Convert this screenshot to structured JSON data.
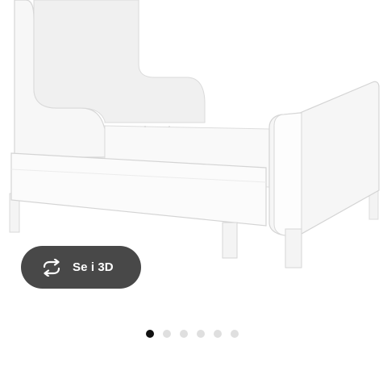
{
  "product": {
    "image_name": "extendable-bed-white"
  },
  "view_3d_button": {
    "label": "Se i 3D",
    "icon": "rotate-3d-icon",
    "background": "#484848",
    "text_color": "#ffffff"
  },
  "carousel": {
    "total_slides": 6,
    "active_slide": 1,
    "active_color": "#111111",
    "inactive_color": "#dfdfdf"
  }
}
